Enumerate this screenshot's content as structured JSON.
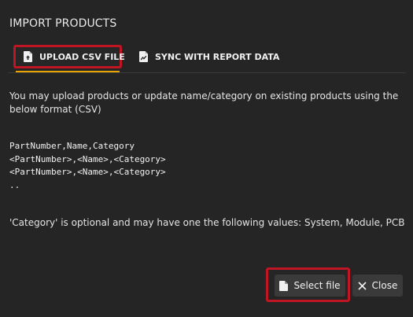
{
  "dialog": {
    "title": "IMPORT PRODUCTS"
  },
  "tabs": [
    {
      "label": "UPLOAD CSV FILE",
      "icon": "file-upload-icon",
      "active": true
    },
    {
      "label": "SYNC WITH REPORT DATA",
      "icon": "chart-file-icon",
      "active": false
    }
  ],
  "content": {
    "description": "You may upload products or update name/category on existing products using the below format (CSV)",
    "format_lines": [
      "PartNumber,Name,Category",
      "<PartNumber>,<Name>,<Category>",
      "<PartNumber>,<Name>,<Category>",
      ".."
    ],
    "note": "'Category' is optional and may have one the following values: System, Module, PCB"
  },
  "buttons": {
    "select_file_label": "Select file",
    "select_file_icon": "file-icon",
    "close_label": "Close",
    "close_icon": "close-icon"
  },
  "colors": {
    "background": "#252525",
    "accent_underline": "#e8a400",
    "highlight_border": "#c01522",
    "button_bg": "#3a3a3a"
  }
}
